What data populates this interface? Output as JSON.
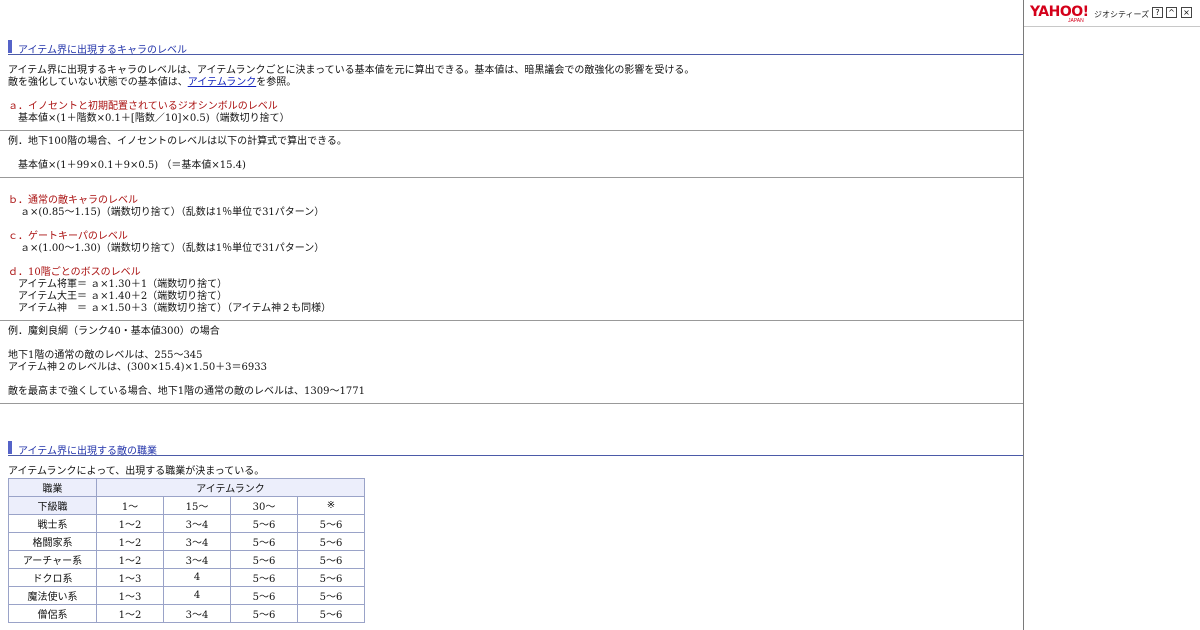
{
  "sidebar": {
    "logo": "YAHOO!",
    "logo_sub": "JAPAN",
    "service": "ジオシティーズ",
    "help": "?",
    "up": "^",
    "close": "×"
  },
  "sec1": {
    "title": "アイテム界に出現するキャラのレベル",
    "intro1": "アイテム界に出現するキャラのレベルは、アイテムランクごとに決まっている基本値を元に算出できる。基本値は、暗黒議会での敵強化の影響を受ける。",
    "intro2a": "敵を強化していない状態での基本値は、",
    "intro2_link": "アイテムランク",
    "intro2b": "を参照。",
    "a_title": "ａ．イノセントと初期配置されているジオシンボルのレベル",
    "a_formula": "基本値×(1＋階数×0.1＋[階数／10]×0.5)（端数切り捨て）",
    "ex1": "例．地下100階の場合、イノセントのレベルは以下の計算式で算出できる。",
    "ex1_formula": "基本値×(1＋99×0.1＋9×0.5) （＝基本値×15.4)",
    "b_title": "ｂ．通常の敵キャラのレベル",
    "b_formula": "ａ×(0.85～1.15)（端数切り捨て）（乱数は1％単位で31パターン）",
    "c_title": "ｃ．ゲートキーパのレベル",
    "c_formula": "ａ×(1.00～1.30)（端数切り捨て）（乱数は1％単位で31パターン）",
    "d_title": "ｄ．10階ごとのボスのレベル",
    "d1": "アイテム将軍＝ ａ×1.30＋1（端数切り捨て）",
    "d2": "アイテム大王＝ ａ×1.40＋2（端数切り捨て）",
    "d3": "アイテム神　＝ ａ×1.50＋3（端数切り捨て）（アイテム神２も同様）",
    "ex2": "例．魔剣良綱（ランク40・基本値300）の場合",
    "ex2_l1": "地下1階の通常の敵のレベルは、255～345",
    "ex2_l2": "アイテム神２のレベルは、(300×15.4)×1.50＋3＝6933",
    "ex2_l3": "敵を最高まで強くしている場合、地下1階の通常の敵のレベルは、1309～1771"
  },
  "sec2": {
    "title": "アイテム界に出現する敵の職業",
    "intro": "アイテムランクによって、出現する職業が決まっている。",
    "table": {
      "h_job": "職業",
      "h_rank": "アイテムランク",
      "h_lower": "下級職",
      "cols": [
        "1～",
        "15～",
        "30～",
        "※"
      ],
      "rows": [
        {
          "name": "戦士系",
          "cells": [
            "1～2",
            "3～4",
            "5～6",
            "5～6"
          ]
        },
        {
          "name": "格闘家系",
          "cells": [
            "1～2",
            "3～4",
            "5～6",
            "5～6"
          ]
        },
        {
          "name": "アーチャー系",
          "cells": [
            "1～2",
            "3～4",
            "5～6",
            "5～6"
          ]
        },
        {
          "name": "ドクロ系",
          "cells": [
            "1～3",
            "4",
            "5～6",
            "5～6"
          ]
        },
        {
          "name": "魔法使い系",
          "cells": [
            "1～3",
            "4",
            "5～6",
            "5～6"
          ]
        },
        {
          "name": "僧侶系",
          "cells": [
            "1～2",
            "3～4",
            "5～6",
            "5～6"
          ]
        }
      ]
    }
  }
}
